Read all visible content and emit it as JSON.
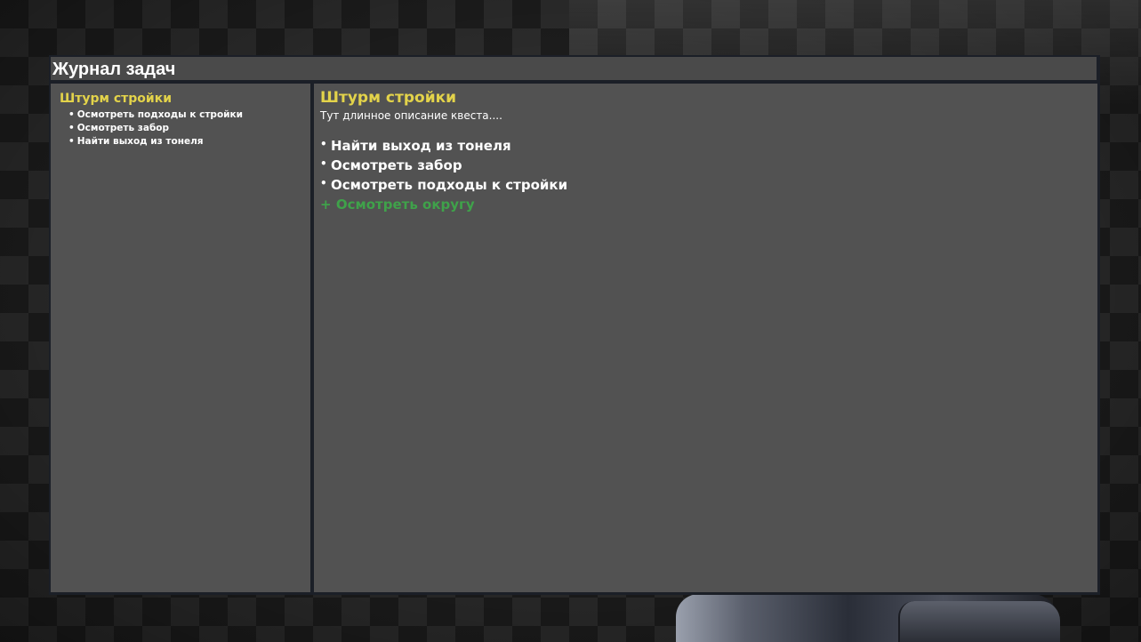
{
  "window": {
    "title": "Журнал задач"
  },
  "quest_list": {
    "quests": [
      {
        "title": "Штурм стройки",
        "objectives": [
          "Осмотреть подходы к стройки",
          "Осмотреть забор",
          "Найти выход из тонеля"
        ]
      }
    ]
  },
  "quest_details": {
    "title": "Штурм стройки",
    "description": "Тут длинное описание квеста....",
    "objectives": [
      {
        "bullet": "•",
        "text": "Найти выход из тонеля"
      },
      {
        "bullet": "•",
        "text": "Осмотреть забор"
      },
      {
        "bullet": "•",
        "text": "Осмотреть подходы к стройки"
      }
    ],
    "added_objective": {
      "prefix": "+",
      "text": "Осмотреть округу"
    }
  },
  "bullet_symbol": "•",
  "colors": {
    "quest_title": "#e3d34a",
    "objective_text": "#ffffff",
    "added_objective": "#3fa24a",
    "panel_bg": "#525252",
    "frame": "#1b1f27"
  }
}
